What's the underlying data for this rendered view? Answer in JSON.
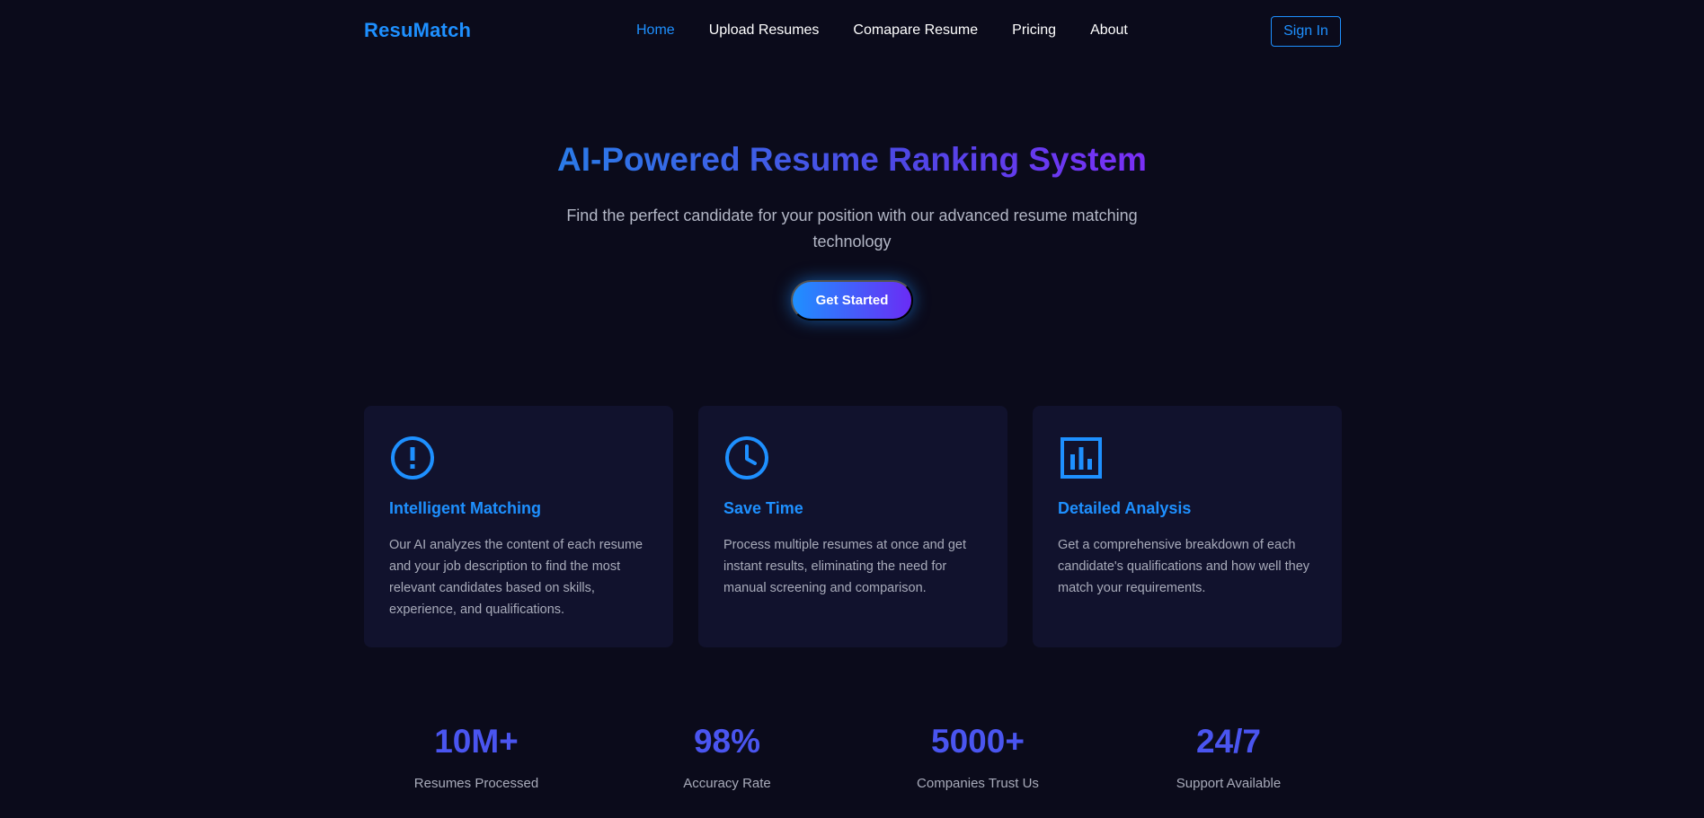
{
  "brand": {
    "name": "ResuMatch"
  },
  "nav": {
    "links": [
      {
        "label": "Home",
        "active": true
      },
      {
        "label": "Upload Resumes",
        "active": false
      },
      {
        "label": "Comapare Resume",
        "active": false
      },
      {
        "label": "Pricing",
        "active": false
      },
      {
        "label": "About",
        "active": false
      }
    ],
    "signin_label": "Sign In"
  },
  "hero": {
    "title": "AI-Powered Resume Ranking System",
    "subtitle": "Find the perfect candidate for your position with our advanced resume matching technology",
    "cta_label": "Get Started"
  },
  "features": [
    {
      "icon": "alert-circle-icon",
      "title": "Intelligent Matching",
      "description": "Our AI analyzes the content of each resume and your job description to find the most relevant candidates based on skills, experience, and qualifications."
    },
    {
      "icon": "clock-icon",
      "title": "Save Time",
      "description": "Process multiple resumes at once and get instant results, eliminating the need for manual screening and comparison."
    },
    {
      "icon": "bar-chart-icon",
      "title": "Detailed Analysis",
      "description": "Get a comprehensive breakdown of each candidate's qualifications and how well they match your requirements."
    }
  ],
  "stats": [
    {
      "value": "10M+",
      "label": "Resumes Processed"
    },
    {
      "value": "98%",
      "label": "Accuracy Rate"
    },
    {
      "value": "5000+",
      "label": "Companies Trust Us"
    },
    {
      "value": "24/7",
      "label": "Support Available"
    }
  ],
  "colors": {
    "background": "#0b0b1b",
    "accent": "#1e90ff",
    "card": "#11122d",
    "stat": "#4a55f0"
  }
}
